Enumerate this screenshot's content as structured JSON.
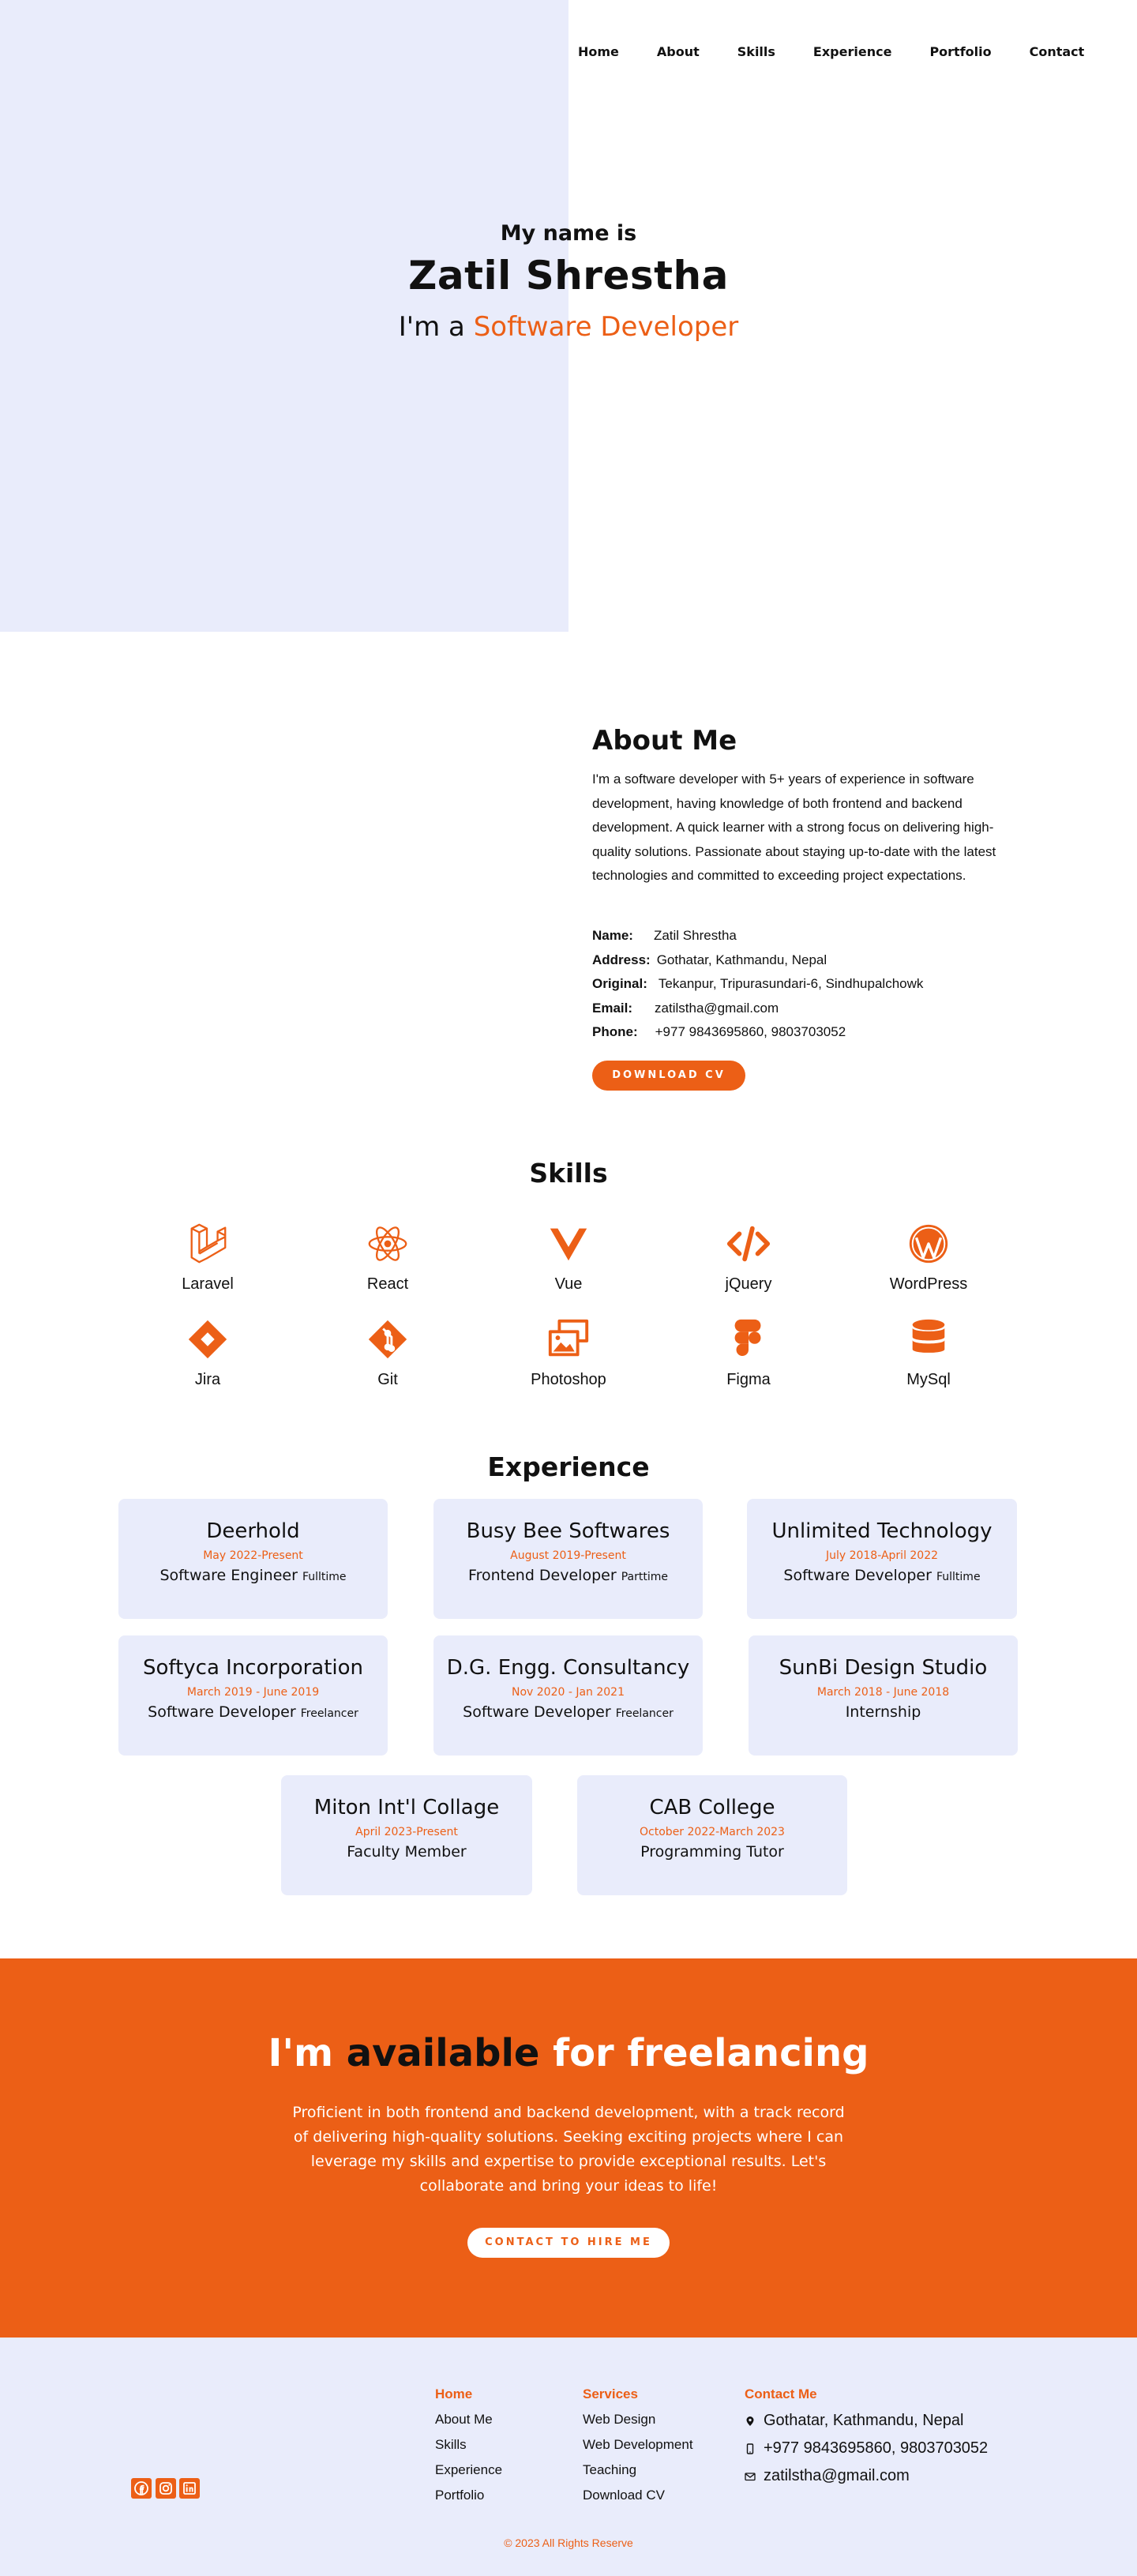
{
  "nav": {
    "items": [
      "Home",
      "About",
      "Skills",
      "Experience",
      "Portfolio",
      "Contact"
    ]
  },
  "hero": {
    "intro": "My name is",
    "name": "Zatil Shrestha",
    "role_prefix": "I'm a ",
    "role_highlight": "Software Developer"
  },
  "about": {
    "title": "About Me",
    "text": "I'm a software developer with 5+ years of experience in software development, having knowledge of both frontend and backend development. A quick learner with a strong focus on delivering high-quality solutions. Passionate about staying up-to-date with the latest technologies and committed to exceeding project expectations.",
    "info": [
      {
        "key": "Name:",
        "value": "Zatil Shrestha"
      },
      {
        "key": "Address:",
        "value": "Gothatar, Kathmandu, Nepal"
      },
      {
        "key": "Original:",
        "value": "Tekanpur, Tripurasundari-6, Sindhupalchowk"
      },
      {
        "key": "Email:",
        "value": "zatilstha@gmail.com"
      },
      {
        "key": "Phone:",
        "value": "+977 9843695860, 9803703052"
      }
    ],
    "cv_button": "DOWNLOAD CV"
  },
  "skills": {
    "title": "Skills",
    "items": [
      {
        "label": "Laravel",
        "icon": "laravel-icon"
      },
      {
        "label": "React",
        "icon": "react-icon"
      },
      {
        "label": "Vue",
        "icon": "vue-icon"
      },
      {
        "label": "jQuery",
        "icon": "code-icon"
      },
      {
        "label": "WordPress",
        "icon": "wordpress-icon"
      },
      {
        "label": "Jira",
        "icon": "jira-icon"
      },
      {
        "label": "Git",
        "icon": "git-icon"
      },
      {
        "label": "Photoshop",
        "icon": "images-icon"
      },
      {
        "label": "Figma",
        "icon": "figma-icon"
      },
      {
        "label": "MySql",
        "icon": "database-icon"
      }
    ]
  },
  "experience": {
    "title": "Experience",
    "items": [
      {
        "company": "Deerhold",
        "dates": "May 2022-Present",
        "role": "Software Engineer",
        "type": "Fulltime"
      },
      {
        "company": "Busy Bee Softwares",
        "dates": "August 2019-Present",
        "role": "Frontend Developer",
        "type": "Parttime"
      },
      {
        "company": "Unlimited Technology",
        "dates": "July 2018-April 2022",
        "role": "Software Developer",
        "type": "Fulltime"
      },
      {
        "company": "Softyca Incorporation",
        "dates": "March 2019 - June 2019",
        "role": "Software Developer",
        "type": "Freelancer"
      },
      {
        "company": "D.G. Engg. Consultancy",
        "dates": "Nov 2020 - Jan 2021",
        "role": "Software Developer",
        "type": "Freelancer"
      },
      {
        "company": "SunBi Design Studio",
        "dates": "March 2018 - June 2018",
        "role": "Internship",
        "type": ""
      },
      {
        "company": "Miton Int'l Collage",
        "dates": "April 2023-Present",
        "role": "Faculty Member",
        "type": ""
      },
      {
        "company": "CAB College",
        "dates": "October 2022-March 2023",
        "role": "Programming Tutor",
        "type": ""
      }
    ]
  },
  "freelance": {
    "headline_pre": "I'm ",
    "headline_dark": "available",
    "headline_post": " for freelancing",
    "text": "Proficient in both frontend and backend development, with a track record of delivering high-quality solutions. Seeking exciting projects where I can leverage my skills and expertise to provide exceptional results. Let's collaborate and bring your ideas to life!",
    "button": "CONTACT TO HIRE ME"
  },
  "footer": {
    "social": [
      "facebook-icon",
      "instagram-icon",
      "linkedin-icon"
    ],
    "col1": {
      "items": [
        "Home",
        "About Me",
        "Skills",
        "Experience",
        "Portfolio"
      ]
    },
    "col2": {
      "title": "Services",
      "items": [
        "Web Design",
        "Web Development",
        "Teaching",
        "Download CV"
      ]
    },
    "col3": {
      "title": "Contact Me",
      "address": "Gothatar, Kathmandu, Nepal",
      "phone": "+977 9843695860, 9803703052",
      "email": "zatilstha@gmail.com"
    },
    "copyright": "© 2023 All Rights Reserve"
  },
  "colors": {
    "accent": "#ec5f16",
    "tint": "#e9ecfb"
  }
}
